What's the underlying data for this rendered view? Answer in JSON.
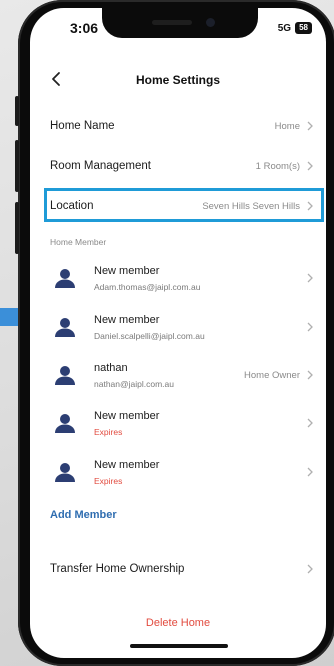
{
  "status_bar": {
    "time": "3:06",
    "network": "5G",
    "battery": "58"
  },
  "header": {
    "title": "Home Settings"
  },
  "settings": [
    {
      "label": "Home Name",
      "value": "Home"
    },
    {
      "label": "Room Management",
      "value": "1 Room(s)"
    },
    {
      "label": "Location",
      "value": "Seven Hills Seven Hills"
    }
  ],
  "members_section": {
    "label": "Home Member"
  },
  "members": [
    {
      "name": "New member",
      "email": "Adam.thomas@jaipl.com.au",
      "expires": "",
      "role": ""
    },
    {
      "name": "New member",
      "email": "Daniel.scalpelli@jaipl.com.au",
      "expires": "",
      "role": ""
    },
    {
      "name": "nathan",
      "email": "nathan@jaipl.com.au",
      "expires": "",
      "role": "Home Owner"
    },
    {
      "name": "New member",
      "email": "",
      "expires": "Expires",
      "role": ""
    },
    {
      "name": "New member",
      "email": "",
      "expires": "Expires",
      "role": ""
    }
  ],
  "actions": {
    "add_member": "Add Member",
    "transfer": "Transfer Home Ownership",
    "delete_home": "Delete Home"
  },
  "colors": {
    "highlight": "#1f9bd7",
    "link": "#2f6db0",
    "danger": "#e24b3f",
    "avatar": "#2c3e73"
  }
}
